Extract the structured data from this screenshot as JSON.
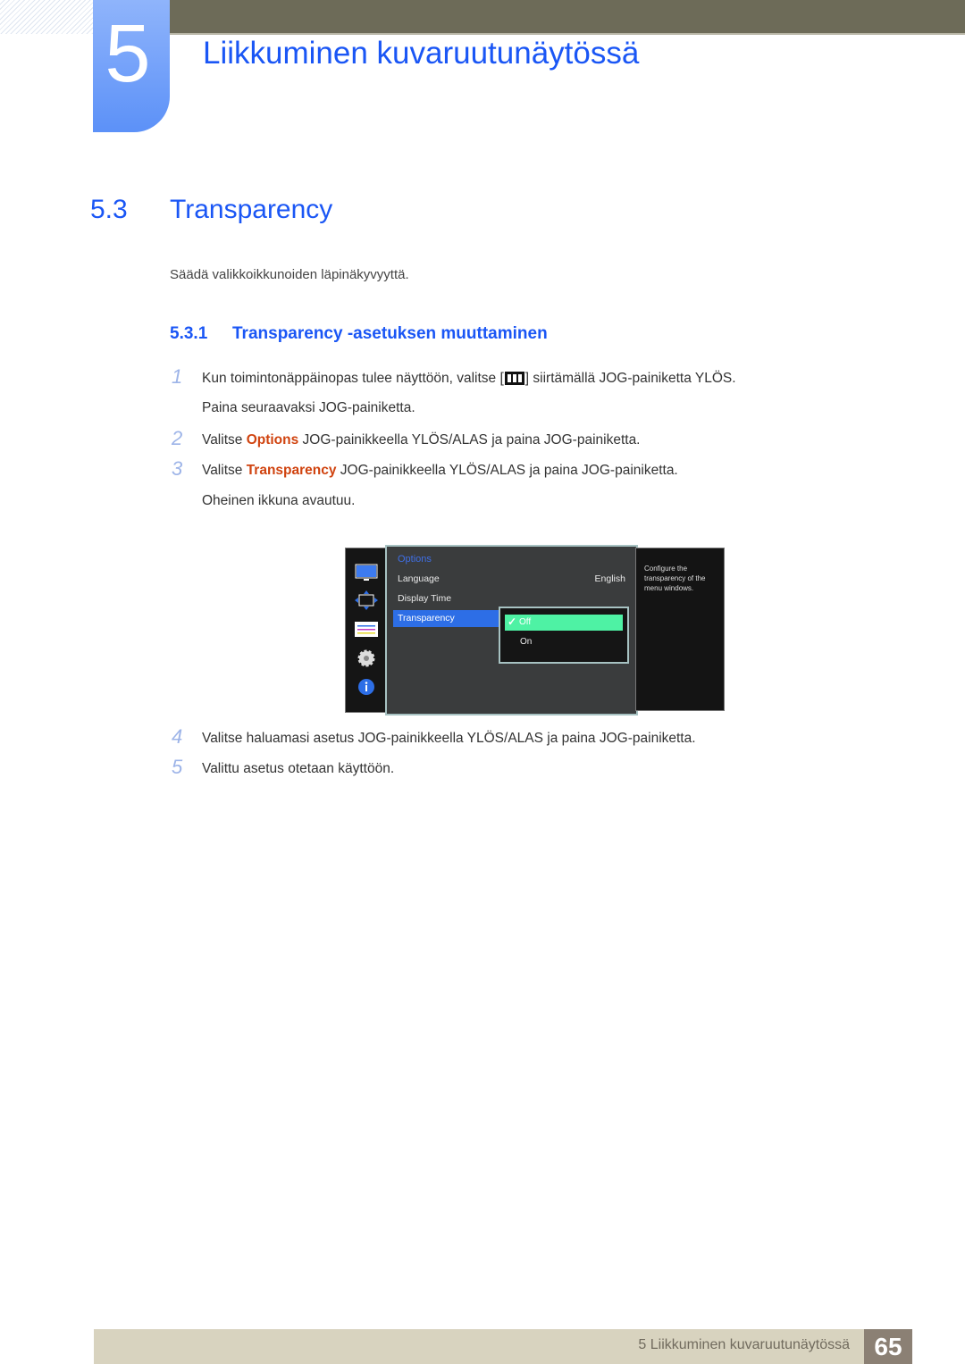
{
  "header": {
    "chapter_number": "5",
    "chapter_title": "Liikkuminen kuvaruutunäytössä"
  },
  "section": {
    "number": "5.3",
    "title": "Transparency",
    "intro": "Säädä valikkoikkunoiden läpinäkyvyyttä."
  },
  "subsection": {
    "number": "5.3.1",
    "title": "Transparency -asetuksen muuttaminen"
  },
  "steps": [
    {
      "num": "1",
      "pre": "Kun toimintonäppäinopas tulee näyttöön, valitse [",
      "icon": "menu-icon",
      "post": "] siirtämällä JOG-painiketta YLÖS.",
      "line2": "Paina seuraavaksi JOG-painiketta."
    },
    {
      "num": "2",
      "pre": "Valitse ",
      "highlight": "Options",
      "post": " JOG-painikkeella YLÖS/ALAS ja paina JOG-painiketta."
    },
    {
      "num": "3",
      "pre": "Valitse ",
      "highlight": "Transparency",
      "post": " JOG-painikkeella YLÖS/ALAS ja paina JOG-painiketta.",
      "line2": "Oheinen ikkuna avautuu."
    },
    {
      "num": "4",
      "text": "Valitse haluamasi asetus JOG-painikkeella YLÖS/ALAS ja paina JOG-painiketta."
    },
    {
      "num": "5",
      "text": "Valittu asetus otetaan käyttöön."
    }
  ],
  "osd": {
    "side_icons": [
      "monitor-icon",
      "size-position-icon",
      "color-bars-icon",
      "gear-icon",
      "info-icon"
    ],
    "heading": "Options",
    "items": [
      {
        "label": "Language",
        "value": "English"
      },
      {
        "label": "Display Time",
        "value": ""
      },
      {
        "label": "Transparency",
        "value": ""
      }
    ],
    "selected_item": "Transparency",
    "options": [
      {
        "label": "Off",
        "selected": true
      },
      {
        "label": "On",
        "selected": false
      }
    ],
    "help_text": "Configure the transparency of the menu windows.",
    "colors": {
      "selection": "#2d6ee6",
      "option_selected": "#4ef2a4"
    }
  },
  "footer": {
    "text": "5 Liikkuminen kuvaruutunäytössä",
    "page": "65"
  },
  "colors": {
    "heading_blue": "#1a56f5",
    "highlight_orange": "#d0430f",
    "top_bar": "#6d6b58"
  }
}
